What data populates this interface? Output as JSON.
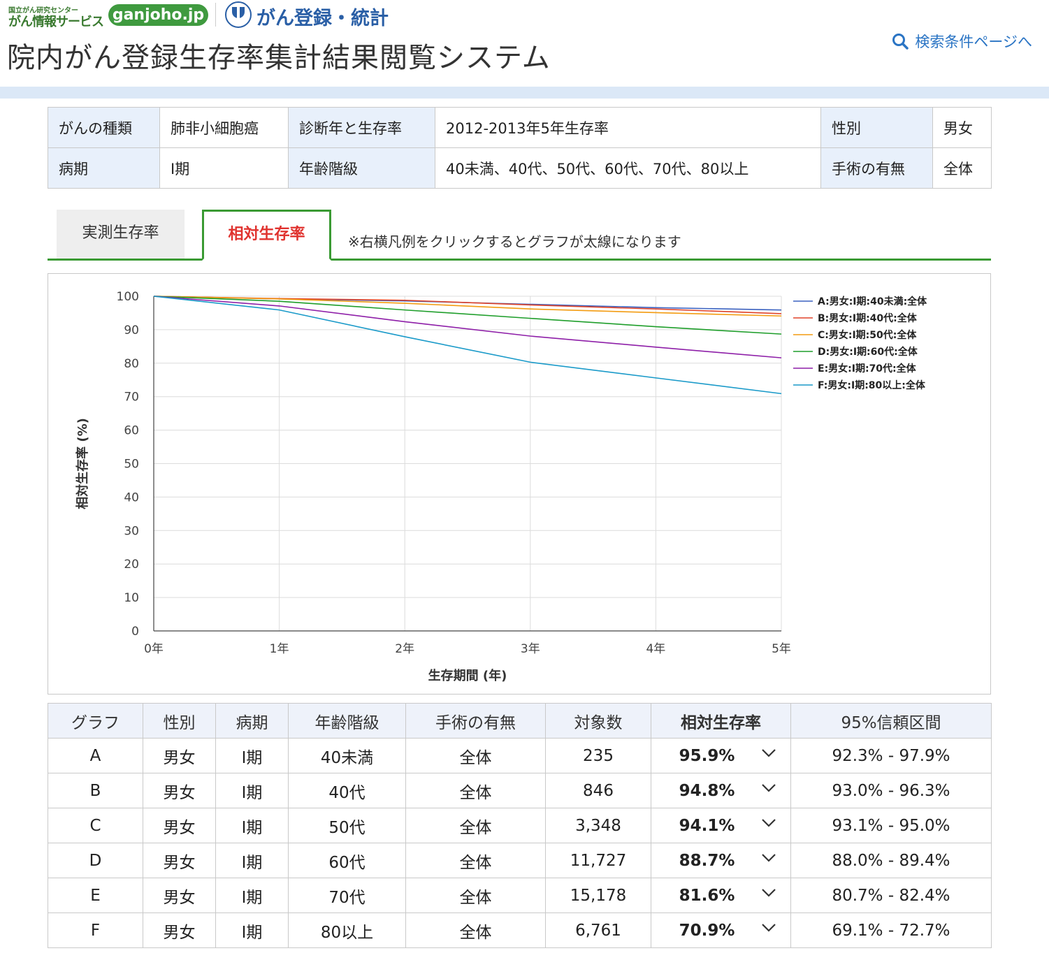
{
  "header": {
    "logo_org": "国立がん研究センター",
    "logo_service": "がん情報サービス",
    "logo_site": "ganjoho.jp",
    "logo_registry": "がん登録・統計",
    "title": "院内がん登録生存率集計結果閲覧システム",
    "search_link": "検索条件ページへ"
  },
  "conditions": {
    "cancer_type_label": "がんの種類",
    "cancer_type": "肺非小細胞癌",
    "diag_label": "診断年と生存率",
    "diag": "2012-2013年5年生存率",
    "sex_label": "性別",
    "sex": "男女",
    "stage_label": "病期",
    "stage": "Ⅰ期",
    "age_label": "年齢階級",
    "age": "40未満、40代、50代、60代、70代、80以上",
    "surgery_label": "手術の有無",
    "surgery": "全体"
  },
  "tabs": {
    "observed": "実測生存率",
    "relative": "相対生存率",
    "note": "※右横凡例をクリックするとグラフが太線になります"
  },
  "chart_data": {
    "type": "line",
    "xlabel": "生存期間 (年)",
    "ylabel": "相対生存率 (%)",
    "x": [
      0,
      1,
      2,
      3,
      4,
      5
    ],
    "x_tick_labels": [
      "0年",
      "1年",
      "2年",
      "3年",
      "4年",
      "5年"
    ],
    "ylim": [
      0,
      100
    ],
    "y_ticks": [
      0,
      10,
      20,
      30,
      40,
      50,
      60,
      70,
      80,
      90,
      100
    ],
    "grid": true,
    "legend_position": "right",
    "series": [
      {
        "name": "A:男女:Ⅰ期:40未満:全体",
        "color": "#3b62c0",
        "values": [
          100,
          99.2,
          98.6,
          97.6,
          96.6,
          95.9
        ]
      },
      {
        "name": "B:男女:Ⅰ期:40代:全体",
        "color": "#e0442a",
        "values": [
          100,
          99.3,
          98.8,
          97.4,
          96.2,
          94.8
        ]
      },
      {
        "name": "C:男女:Ⅰ期:50代:全体",
        "color": "#f39c12",
        "values": [
          100,
          99.2,
          97.9,
          96.2,
          95.1,
          94.1
        ]
      },
      {
        "name": "D:男女:Ⅰ期:60代:全体",
        "color": "#1f9e2b",
        "values": [
          100,
          98.5,
          95.9,
          93.4,
          90.9,
          88.7
        ]
      },
      {
        "name": "E:男女:Ⅰ期:70代:全体",
        "color": "#8e1fa8",
        "values": [
          100,
          97.1,
          92.4,
          88.1,
          84.8,
          81.6
        ]
      },
      {
        "name": "F:男女:Ⅰ期:80以上:全体",
        "color": "#1a9ac9",
        "values": [
          100,
          95.9,
          87.9,
          80.3,
          75.6,
          70.9
        ]
      }
    ]
  },
  "results": {
    "headers": [
      "グラフ",
      "性別",
      "病期",
      "年齢階級",
      "手術の有無",
      "対象数",
      "相対生存率",
      "95%信頼区間"
    ],
    "rows": [
      [
        "A",
        "男女",
        "Ⅰ期",
        "40未満",
        "全体",
        "235",
        "95.9%",
        "92.3% - 97.9%"
      ],
      [
        "B",
        "男女",
        "Ⅰ期",
        "40代",
        "全体",
        "846",
        "94.8%",
        "93.0% - 96.3%"
      ],
      [
        "C",
        "男女",
        "Ⅰ期",
        "50代",
        "全体",
        "3,348",
        "94.1%",
        "93.1% - 95.0%"
      ],
      [
        "D",
        "男女",
        "Ⅰ期",
        "60代",
        "全体",
        "11,727",
        "88.7%",
        "88.0% - 89.4%"
      ],
      [
        "E",
        "男女",
        "Ⅰ期",
        "70代",
        "全体",
        "15,178",
        "81.6%",
        "80.7% - 82.4%"
      ],
      [
        "F",
        "男女",
        "Ⅰ期",
        "80以上",
        "全体",
        "6,761",
        "70.9%",
        "69.1% - 72.7%"
      ]
    ]
  }
}
